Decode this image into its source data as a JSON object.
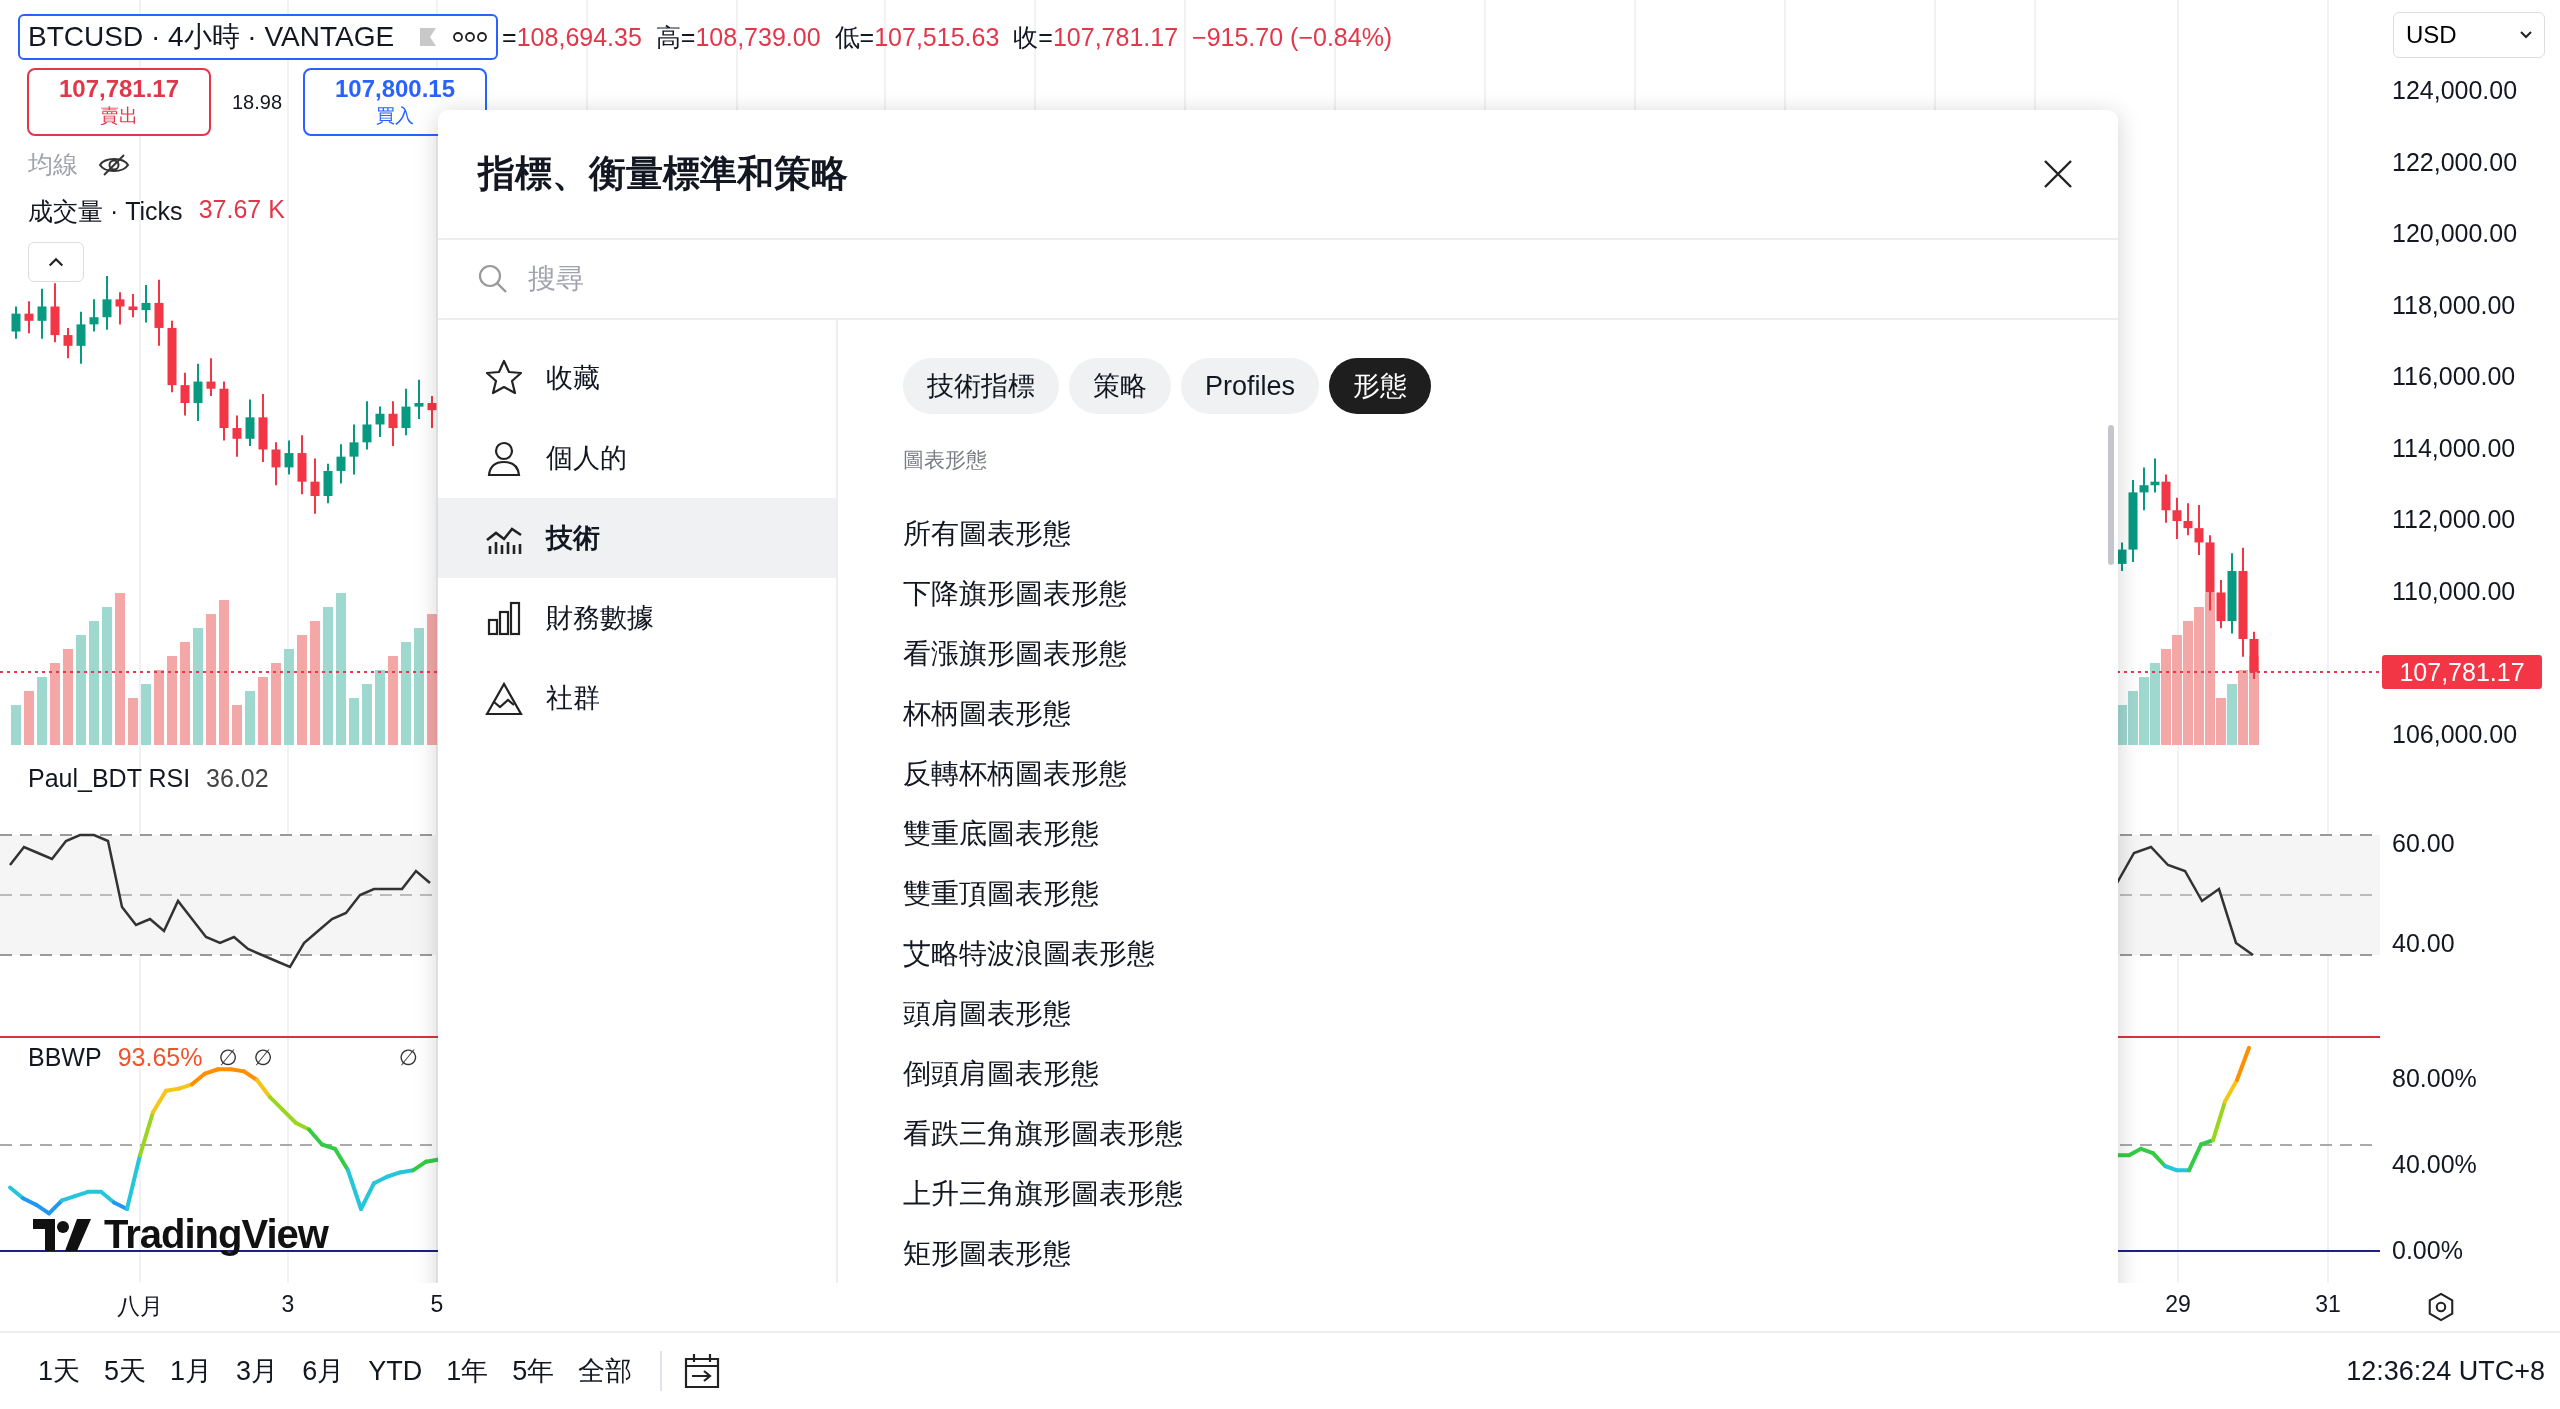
{
  "symbol": {
    "title": "BTCUSD · 4小時 · VANTAGE"
  },
  "ohlc": [
    {
      "label": "=",
      "value": "108,694.35"
    },
    {
      "label": "高=",
      "value": "108,739.00"
    },
    {
      "label": "低=",
      "value": "107,515.63"
    },
    {
      "label": "收=",
      "value": "107,781.17"
    }
  ],
  "change": "−915.70 (−0.84%)",
  "quote": {
    "sell": {
      "price": "107,781.17",
      "label": "賣出"
    },
    "spread": "18.98",
    "buy": {
      "price": "107,800.15",
      "label": "買入"
    }
  },
  "ma": {
    "name": "均線",
    "hidden": true
  },
  "volume": {
    "name": "成交量 · Ticks",
    "value": "37.67 K"
  },
  "rsi": {
    "name": "Paul_BDT RSI",
    "value": "36.02"
  },
  "bbwp": {
    "name": "BBWP",
    "value": "93.65%",
    "extras": [
      "∅",
      "∅",
      "∅"
    ]
  },
  "logo_text": "TradingView",
  "currency": "USD",
  "price_axis": [
    "124,000.00",
    "122,000.00",
    "120,000.00",
    "118,000.00",
    "116,000.00",
    "114,000.00",
    "112,000.00",
    "110,000.00",
    "106,000.00"
  ],
  "last_price": "107,781.17",
  "rsi_axis": [
    "60.00",
    "40.00"
  ],
  "bbwp_axis": [
    "80.00%",
    "40.00%",
    "0.00%"
  ],
  "time_axis": [
    "八月",
    "3",
    "5",
    "29",
    "31"
  ],
  "ranges": [
    "1天",
    "5天",
    "1月",
    "3月",
    "6月",
    "YTD",
    "1年",
    "5年",
    "全部"
  ],
  "clock": "12:36:24 UTC+8",
  "dialog": {
    "title": "指標、衡量標準和策略",
    "search": {
      "placeholder": "搜尋"
    },
    "sidebar": [
      {
        "label": "收藏",
        "selected": false
      },
      {
        "label": "個人的",
        "selected": false
      },
      {
        "label": "技術",
        "selected": true
      },
      {
        "label": "財務數據",
        "selected": false
      },
      {
        "label": "社群",
        "selected": false
      }
    ],
    "tabs": [
      {
        "label": "技術指標",
        "selected": false
      },
      {
        "label": "策略",
        "selected": false
      },
      {
        "label": "Profiles",
        "selected": false
      },
      {
        "label": "形態",
        "selected": true
      }
    ],
    "section": "圖表形態",
    "items": [
      "所有圖表形態",
      "下降旗形圖表形態",
      "看漲旗形圖表形態",
      "杯柄圖表形態",
      "反轉杯柄圖表形態",
      "雙重底圖表形態",
      "雙重頂圖表形態",
      "艾略特波浪圖表形態",
      "頭肩圖表形態",
      "倒頭肩圖表形態",
      "看跌三角旗形圖表形態",
      "上升三角旗形圖表形態",
      "矩形圖表形態"
    ]
  }
}
